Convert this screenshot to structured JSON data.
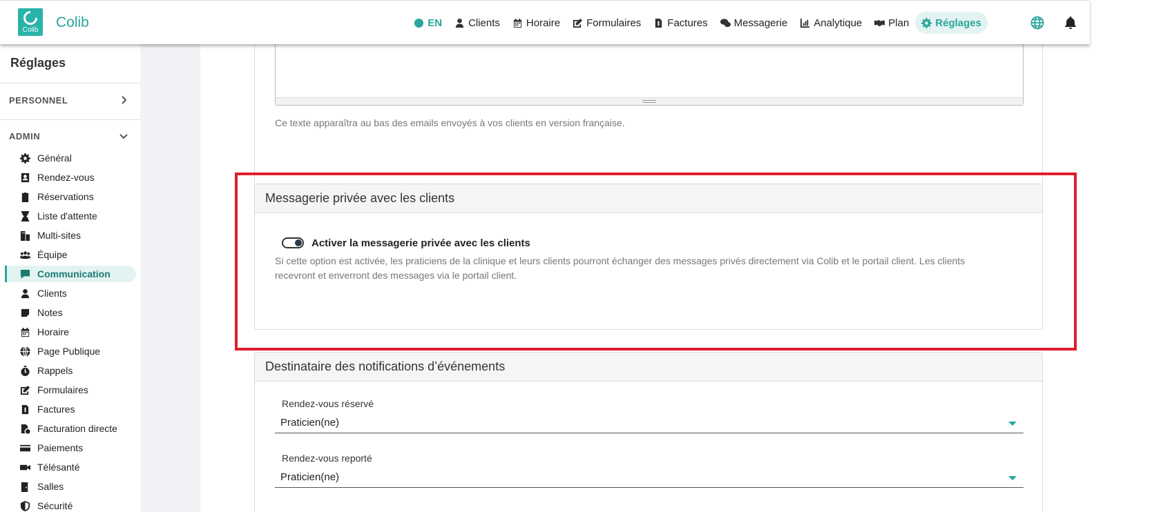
{
  "brand": {
    "name": "Colib",
    "logo_text": "Colib"
  },
  "nav": {
    "lang": "EN",
    "items": [
      {
        "label": "Clients",
        "icon": "user-icon"
      },
      {
        "label": "Horaire",
        "icon": "calendar-icon"
      },
      {
        "label": "Formulaires",
        "icon": "form-icon"
      },
      {
        "label": "Factures",
        "icon": "invoice-icon"
      },
      {
        "label": "Messagerie",
        "icon": "chat-icon"
      },
      {
        "label": "Analytique",
        "icon": "chart-icon"
      },
      {
        "label": "Plan",
        "icon": "handshake-icon"
      },
      {
        "label": "Réglages",
        "icon": "gear-icon"
      }
    ]
  },
  "sidebar": {
    "title": "Réglages",
    "sections": [
      {
        "label": "PERSONNEL"
      },
      {
        "label": "ADMIN"
      }
    ],
    "items": [
      {
        "label": "Général",
        "icon": "gear-icon"
      },
      {
        "label": "Rendez-vous",
        "icon": "calendar-user-icon"
      },
      {
        "label": "Réservations",
        "icon": "clipboard-icon"
      },
      {
        "label": "Liste d'attente",
        "icon": "hourglass-icon"
      },
      {
        "label": "Multi-sites",
        "icon": "buildings-icon"
      },
      {
        "label": "Équipe",
        "icon": "users-icon"
      },
      {
        "label": "Communication",
        "icon": "message-icon"
      },
      {
        "label": "Clients",
        "icon": "user-icon"
      },
      {
        "label": "Notes",
        "icon": "note-icon"
      },
      {
        "label": "Horaire",
        "icon": "calendar-icon"
      },
      {
        "label": "Page Publique",
        "icon": "globe-icon"
      },
      {
        "label": "Rappels",
        "icon": "stopwatch-icon"
      },
      {
        "label": "Formulaires",
        "icon": "form-icon"
      },
      {
        "label": "Factures",
        "icon": "invoice-icon"
      },
      {
        "label": "Facturation directe",
        "icon": "file-clock-icon"
      },
      {
        "label": "Paiements",
        "icon": "credit-card-icon"
      },
      {
        "label": "Télésanté",
        "icon": "video-icon"
      },
      {
        "label": "Salles",
        "icon": "door-icon"
      },
      {
        "label": "Sécurité",
        "icon": "shield-icon"
      }
    ],
    "active_item": "Communication"
  },
  "main": {
    "footer_help": "Ce texte apparaîtra au bas des emails envoyés à vos clients en version française.",
    "messaging": {
      "title": "Messagerie privée avec les clients",
      "toggle_label": "Activer la messagerie privée avec les clients",
      "toggle_on": true,
      "help_line1": "Si cette option est activée, les praticiens de la clinique et leurs clients pourront échanger des messages privés directement via Colib et le portail client. Les clients",
      "help_line2": "recevront et enverront des messages via le portail client."
    },
    "notifications": {
      "title": "Destinataire des notifications d’événements",
      "fields": [
        {
          "label": "Rendez-vous réservé",
          "value": "Praticien(ne)"
        },
        {
          "label": "Rendez-vous reporté",
          "value": "Praticien(ne)"
        }
      ]
    }
  },
  "colors": {
    "accent": "#2aa59b",
    "highlight": "#e01e2a"
  }
}
